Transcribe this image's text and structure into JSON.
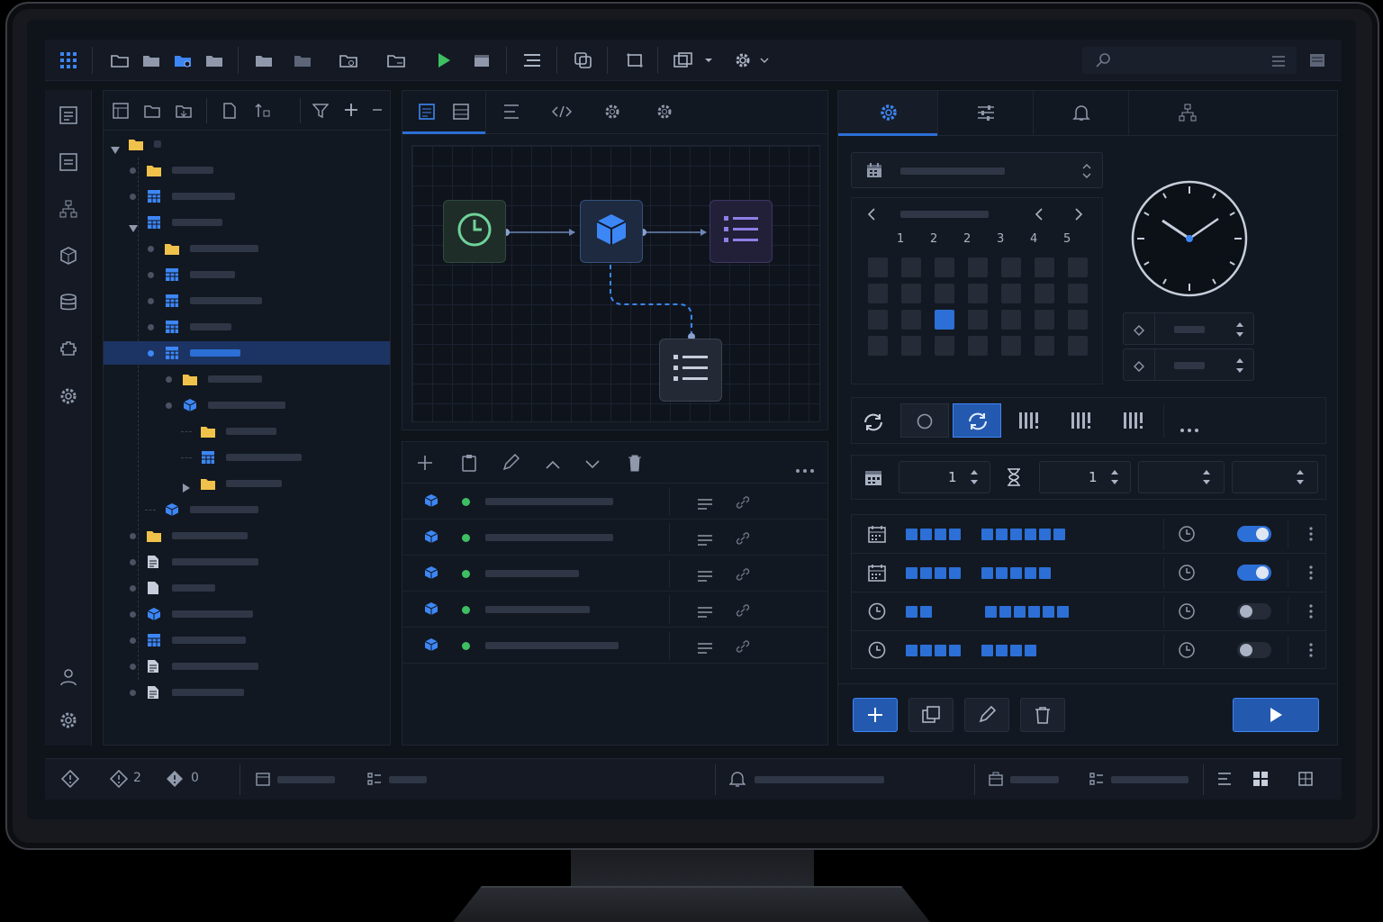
{
  "colors": {
    "accent": "#2c6fd6",
    "folder": "#f0c24b",
    "ok": "#3fbf62",
    "play": "#3fbf62"
  },
  "calendar": {
    "day_labels": [
      "1",
      "2",
      "2",
      "3",
      "4",
      "5"
    ],
    "selected_index": 16
  },
  "spinners": {
    "a": "1",
    "b": "1"
  },
  "schedule": {
    "rows": [
      {
        "icon": "calendar-icon",
        "on": true,
        "a": 4,
        "b": 6
      },
      {
        "icon": "calendar-icon",
        "on": true,
        "a": 4,
        "b": 5
      },
      {
        "icon": "clock-icon",
        "on": false,
        "a": 2,
        "b": 6
      },
      {
        "icon": "clock-icon",
        "on": false,
        "a": 4,
        "b": 4
      }
    ]
  },
  "status": {
    "warnings": "2",
    "errors": "0"
  }
}
